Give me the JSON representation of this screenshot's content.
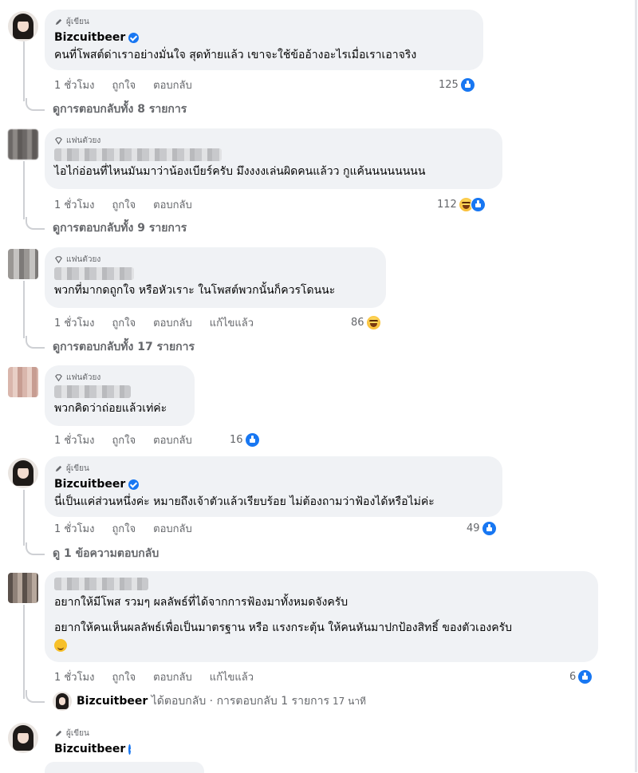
{
  "comments": [
    {
      "badge": "ผู้เขียน",
      "name": "Bizcuitbeer",
      "text": [
        "คนที่โพสต์ด่าเราอย่างมั่นใจ สุดท้ายแล้ว เขาจะใช้ข้ออ้างอะไรเมื่อเราเอาจริง"
      ],
      "time": "1 ชั่วโมง",
      "like": "ถูกใจ",
      "reply": "ตอบกลับ",
      "reaction_count": "125",
      "reaction": "like",
      "replies_label": "ดูการตอบกลับทั้ง 8 รายการ"
    },
    {
      "badge": "แฟนตัวยง",
      "text": [
        "ไอไก่อ่อนที่ไหนมันมาว่าน้องเบียร์ครับ มึงงงงเล่นผิดคนแล้วว กูแค้นนนนนนนน"
      ],
      "time": "1 ชั่วโมง",
      "like": "ถูกใจ",
      "reply": "ตอบกลับ",
      "reaction_count": "112",
      "reaction": "haha-like",
      "replies_label": "ดูการตอบกลับทั้ง 9 รายการ"
    },
    {
      "badge": "แฟนตัวยง",
      "text": [
        "พวกที่มากดถูกใจ หรือหัวเราะ ในโพสต์พวกนั้นก็ควรโดนนะ"
      ],
      "time": "1 ชั่วโมง",
      "like": "ถูกใจ",
      "reply": "ตอบกลับ",
      "edited": "แก้ไขแล้ว",
      "reaction_count": "86",
      "reaction": "haha",
      "replies_label": "ดูการตอบกลับทั้ง 17 รายการ"
    },
    {
      "badge": "แฟนตัวยง",
      "text": [
        "พวกคิดว่าถ่อยแล้วเท่ค่ะ"
      ],
      "time": "1 ชั่วโมง",
      "like": "ถูกใจ",
      "reply": "ตอบกลับ",
      "reaction_count": "16",
      "reaction": "like"
    },
    {
      "badge": "ผู้เขียน",
      "name": "Bizcuitbeer",
      "text": [
        "นี่เป็นแค่ส่วนหนึ่งค่ะ หมายถึงเจ้าตัวแล้วเรียบร้อย ไม่ต้องถามว่าฟ้องได้หรือไม่ค่ะ"
      ],
      "time": "1 ชั่วโมง",
      "like": "ถูกใจ",
      "reply": "ตอบกลับ",
      "reaction_count": "49",
      "reaction": "like",
      "replies_label": "ดู 1 ข้อความตอบกลับ"
    },
    {
      "text": [
        "อยากให้มีโพส รวมๆ ผลลัพธ์ที่ได้จากการฟ้องมาทั้งหมดจังครับ",
        "อยากให้คนเห็นผลลัพธ์เพื่อเป็นมาตรฐาน หรือ แรงกระตุ้น ให้คนหันมาปกป้องสิทธิ์ ของตัวเองครับ"
      ],
      "time": "1 ชั่วโมง",
      "like": "ถูกใจ",
      "reply": "ตอบกลับ",
      "edited": "แก้ไขแล้ว",
      "reaction_count": "6",
      "reaction": "like",
      "reply_summary": {
        "name": "Bizcuitbeer",
        "rest": "ได้ตอบกลับ · การตอบกลับ 1 รายการ",
        "time": "17 นาที"
      }
    },
    {
      "badge": "ผู้เขียน",
      "name": "Bizcuitbeer"
    }
  ],
  "colors": {
    "accent": "#1877f2",
    "bubble": "#f0f2f5",
    "muted": "#65676b"
  }
}
